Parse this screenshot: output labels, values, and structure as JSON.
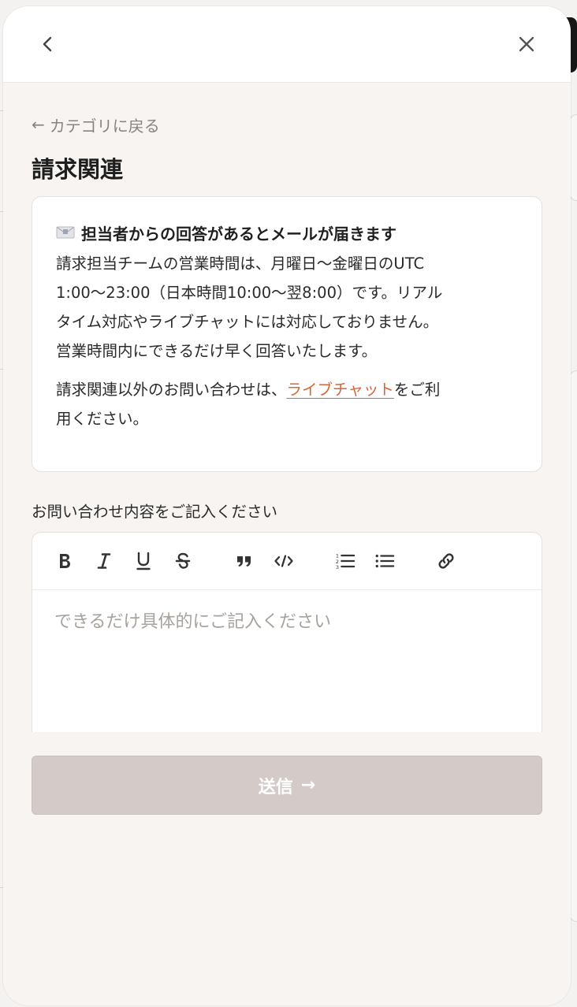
{
  "header": {
    "back_icon": "chevron-left-icon",
    "close_icon": "close-icon"
  },
  "back_link": {
    "arrow": "←",
    "label": "カテゴリに戻る"
  },
  "title": "請求関連",
  "info": {
    "icon": "envelope-icon",
    "heading": "担当者からの回答があるとメールが届きます",
    "body_line1": "請求担当チームの営業時間は、月曜日〜金曜日のUTC",
    "body_line2": "1:00〜23:00（日本時間10:00〜翌8:00）です。リアル",
    "body_line3": "タイム対応やライブチャットには対応しておりません。",
    "body_line4": "営業時間内にできるだけ早く回答いたします。",
    "note_prefix": "請求関連以外のお問い合わせは、",
    "note_link": "ライブチャット",
    "note_suffix_1": "をご利",
    "note_suffix_2": "用ください。"
  },
  "form": {
    "label": "お問い合わせ内容をご記入ください",
    "placeholder": "できるだけ具体的にご記入ください",
    "toolbar": [
      "bold-icon",
      "italic-icon",
      "underline-icon",
      "strikethrough-icon",
      "blockquote-icon",
      "code-icon",
      "ordered-list-icon",
      "bullet-list-icon",
      "link-icon"
    ],
    "submit_label": "送信",
    "submit_arrow": "→"
  },
  "colors": {
    "accent_link": "#d5673a",
    "submit_disabled": "#d4cac8",
    "background": "#f7f4f1"
  }
}
